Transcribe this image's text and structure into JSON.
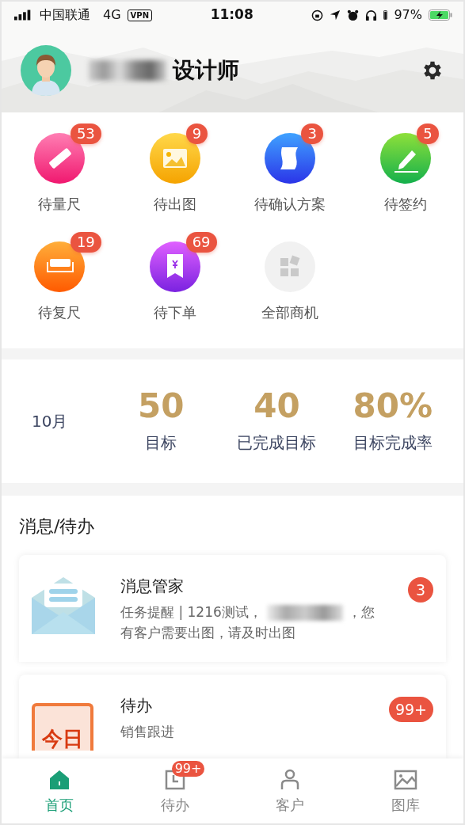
{
  "status_bar": {
    "carrier": "中国联通",
    "network": "4G",
    "vpn": "VPN",
    "time": "11:08",
    "battery": "97%"
  },
  "profile": {
    "role": "设计师"
  },
  "shortcuts": [
    {
      "kind": "ruler",
      "label": "待量尺",
      "count": "53"
    },
    {
      "kind": "image",
      "label": "待出图",
      "count": "9"
    },
    {
      "kind": "scroll",
      "label": "待确认方案",
      "count": "3"
    },
    {
      "kind": "pen",
      "label": "待签约",
      "count": "5"
    },
    {
      "kind": "tray",
      "label": "待复尺",
      "count": "19"
    },
    {
      "kind": "order",
      "label": "待下单",
      "count": "69"
    },
    {
      "kind": "all",
      "label": "全部商机"
    }
  ],
  "stats": {
    "month": "10月",
    "items": [
      {
        "value": "50",
        "label": "目标"
      },
      {
        "value": "40",
        "label": "已完成目标"
      },
      {
        "value": "80%",
        "label": "目标完成率"
      }
    ]
  },
  "messages": {
    "title": "消息/待办",
    "cards": [
      {
        "kind": "mail",
        "title": "消息管家",
        "text_before": "任务提醒 | 1216测试，",
        "text_after": "，您有客户需要出图，请及时出图",
        "count": "3"
      },
      {
        "kind": "today",
        "icon_text": "今日",
        "title": "待办",
        "subtitle": "销售跟进",
        "count": "99+"
      }
    ]
  },
  "tab_bar": [
    {
      "kind": "home",
      "label": "首页",
      "selected": true
    },
    {
      "kind": "todo",
      "label": "待办",
      "selected": false,
      "count": "99+"
    },
    {
      "kind": "customer",
      "label": "客户",
      "selected": false
    },
    {
      "kind": "gallery",
      "label": "图库",
      "selected": false
    }
  ]
}
